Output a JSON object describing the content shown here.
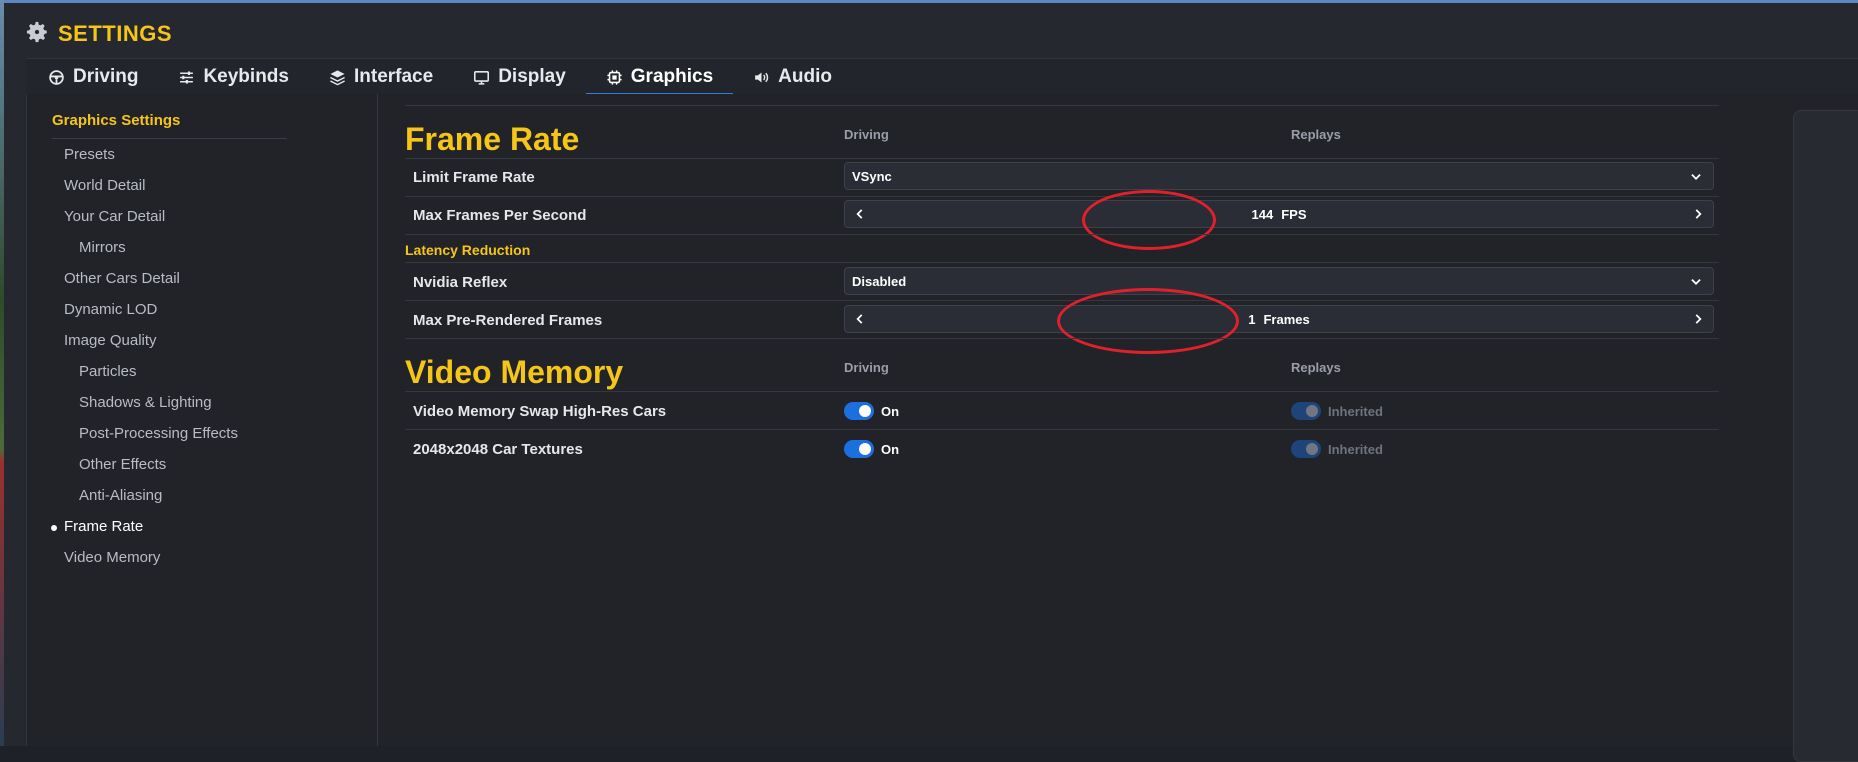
{
  "window": {
    "title": "SETTINGS"
  },
  "tabs": [
    {
      "label": "Driving",
      "icon": "steering-wheel-icon"
    },
    {
      "label": "Keybinds",
      "icon": "sliders-icon"
    },
    {
      "label": "Interface",
      "icon": "layers-icon"
    },
    {
      "label": "Display",
      "icon": "monitor-icon"
    },
    {
      "label": "Graphics",
      "icon": "chip-icon",
      "active": true
    },
    {
      "label": "Audio",
      "icon": "speaker-icon"
    }
  ],
  "sidebar": {
    "title": "Graphics Settings",
    "items": [
      {
        "label": "Presets"
      },
      {
        "label": "World Detail"
      },
      {
        "label": "Your Car Detail"
      },
      {
        "label": "Mirrors"
      },
      {
        "label": "Other Cars Detail"
      },
      {
        "label": "Dynamic LOD"
      },
      {
        "label": "Image Quality"
      },
      {
        "label": "Particles"
      },
      {
        "label": "Shadows & Lighting"
      },
      {
        "label": "Post-Processing Effects"
      },
      {
        "label": "Other Effects"
      },
      {
        "label": "Anti-Aliasing"
      },
      {
        "label": "Frame Rate",
        "active": true
      },
      {
        "label": "Video Memory"
      }
    ]
  },
  "frame_rate": {
    "heading": "Frame Rate",
    "col_driving": "Driving",
    "col_replays": "Replays",
    "limit_frame_rate": {
      "label": "Limit Frame Rate",
      "value": "VSync"
    },
    "max_fps": {
      "label": "Max Frames Per Second",
      "value": "144",
      "unit": "FPS"
    },
    "latency_heading": "Latency Reduction",
    "nvidia_reflex": {
      "label": "Nvidia Reflex",
      "value": "Disabled"
    },
    "max_prerendered": {
      "label": "Max Pre-Rendered Frames",
      "value": "1",
      "unit": "Frames"
    }
  },
  "video_memory": {
    "heading": "Video Memory",
    "col_driving": "Driving",
    "col_replays": "Replays",
    "swap_high_res": {
      "label": "Video Memory Swap High-Res Cars",
      "driving": "On",
      "replays": "Inherited"
    },
    "car_textures": {
      "label": "2048x2048 Car Textures",
      "driving": "On",
      "replays": "Inherited"
    }
  },
  "colors": {
    "accent": "#f5c518",
    "tab_underline": "#2f7fe0",
    "toggle_on": "#1d6fe0",
    "annotation": "#e0212b"
  }
}
